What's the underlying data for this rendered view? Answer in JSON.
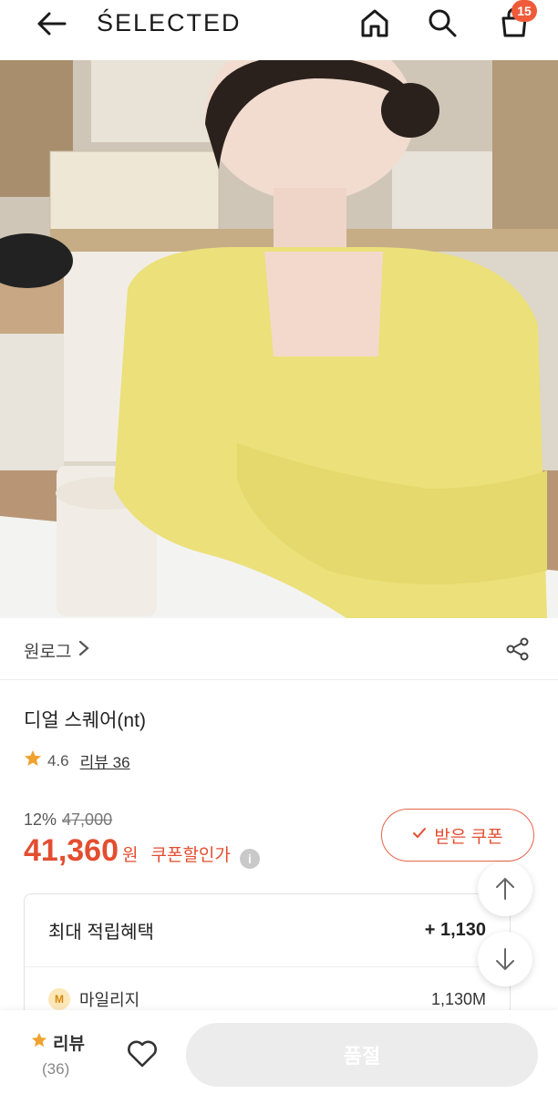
{
  "header": {
    "brand": "ŚELECTED",
    "cart_count": "15"
  },
  "product": {
    "brand_name": "원로그",
    "title": "디얼 스퀘어(nt)",
    "rating": "4.6",
    "review_label": "리뷰 36",
    "discount_rate": "12%",
    "original_price": "47,000",
    "price": "41,360",
    "currency": "원",
    "coupon_price_label": "쿠폰할인가",
    "coupon_button": "받은 쿠폰"
  },
  "benefits": {
    "title": "최대 적립혜택",
    "total": "+ 1,130",
    "rows": [
      {
        "icon": "M",
        "label": "마일리지",
        "value": "1,130M"
      }
    ]
  },
  "bottom_bar": {
    "review_label": "리뷰",
    "review_count": "(36)",
    "soldout_label": "품절"
  },
  "colors": {
    "accent": "#e34e30",
    "badge": "#ef5b3a",
    "star": "#f0a22e"
  }
}
